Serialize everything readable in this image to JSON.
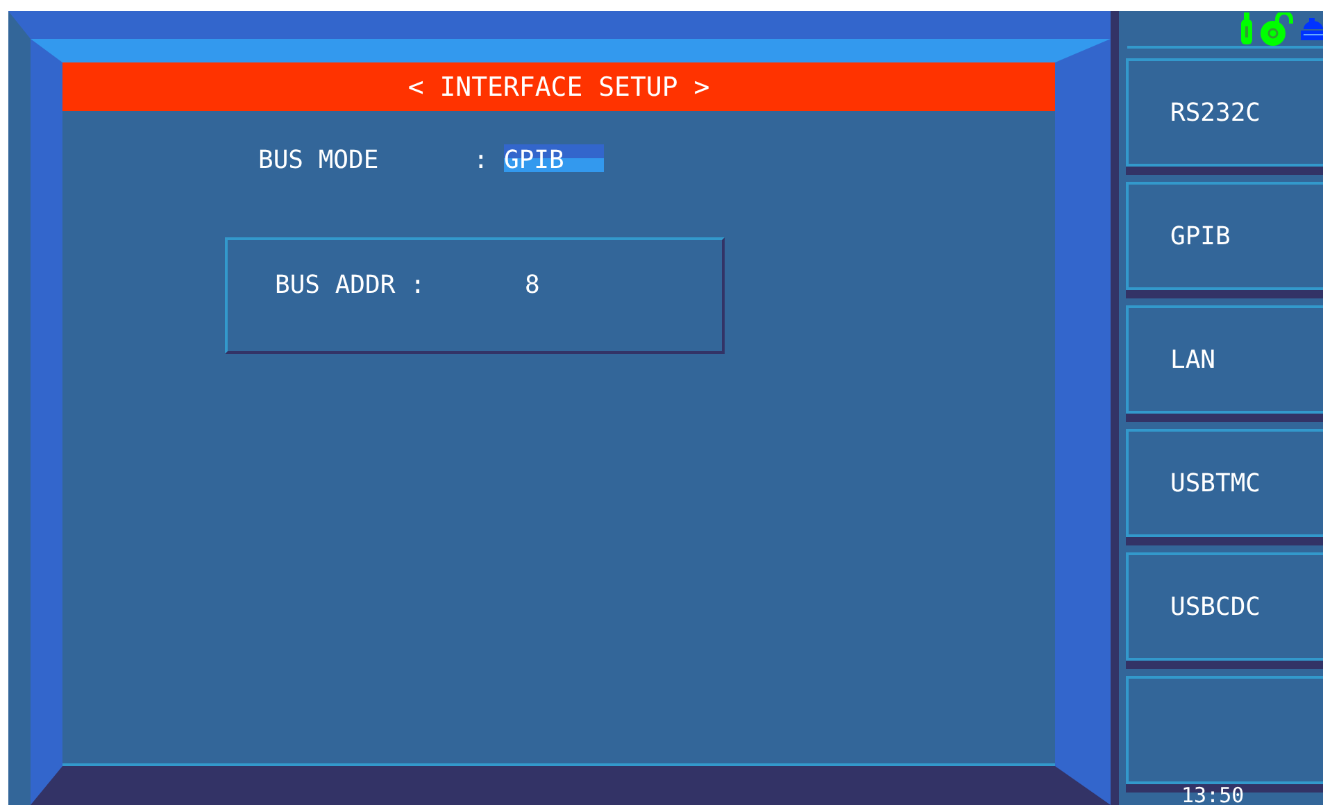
{
  "title": "< INTERFACE SETUP >",
  "bus_mode": {
    "label": "BUS MODE",
    "separator": ":",
    "value": "GPIB",
    "selected": true
  },
  "bus_addr": {
    "label": "BUS ADDR :",
    "value": "8"
  },
  "softkeys": [
    {
      "kind": "key",
      "label": "RS232C"
    },
    {
      "kind": "key",
      "label": "GPIB"
    },
    {
      "kind": "key",
      "label": "LAN"
    },
    {
      "kind": "key",
      "label": "USBTMC"
    },
    {
      "kind": "key",
      "label": "USBCDC"
    },
    {
      "kind": "blank"
    }
  ],
  "status_bar": {
    "time": "13:50"
  }
}
